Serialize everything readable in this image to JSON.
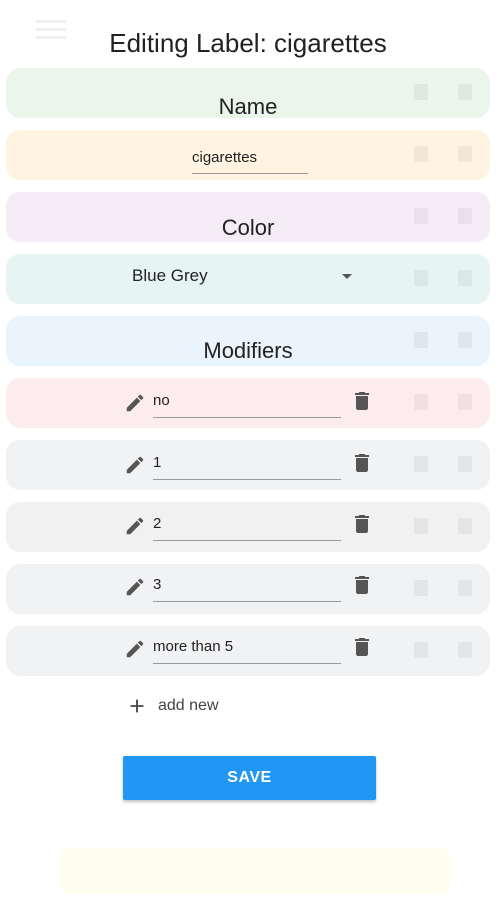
{
  "dialog": {
    "title": "Editing Label: cigarettes",
    "name_label": "Name",
    "name_value": "cigarettes",
    "color_label": "Color",
    "color_value": "Blue Grey",
    "modifiers_label": "Modifiers",
    "modifiers": [
      {
        "value": "no"
      },
      {
        "value": "1"
      },
      {
        "value": "2"
      },
      {
        "value": "3"
      },
      {
        "value": "more than 5"
      }
    ],
    "add_new_label": "add new",
    "save_label": "SAVE"
  },
  "background": {
    "row_colors": [
      "#e8f5e9",
      "#fff3e0",
      "#f3e5f5",
      "#e0f2f1",
      "#e3f2fd",
      "#ffebee",
      "#eceff1",
      "#eeeeee",
      "#eceff1",
      "#eceff1"
    ]
  },
  "icons": {
    "edit": "pencil-icon",
    "delete": "trash-icon",
    "add": "plus-icon",
    "dropdown": "caret-down-icon"
  },
  "colors": {
    "accent": "#2196f3",
    "icon": "#555555"
  }
}
